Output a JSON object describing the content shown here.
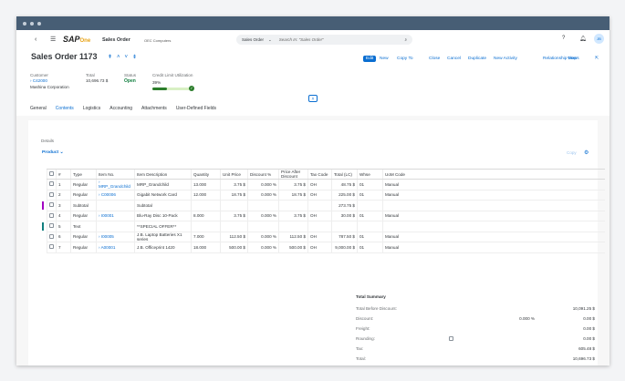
{
  "app": {
    "logo": "SAP Business One",
    "module": "Sales Order",
    "company": "OEC Computers",
    "search_scope": "Sales Order",
    "search_placeholder": "Search In: \"Sales Order\"",
    "avatar": "JB"
  },
  "header": {
    "title": "Sales Order 1173",
    "customer_label": "Customer",
    "customer_code": "C42000",
    "customer_name": "Mashina Corporation",
    "total_label": "Total",
    "total": "10,696.73 $",
    "status_label": "Status",
    "status": "Open",
    "credit_label": "Credit Limit Utilization",
    "credit_pct": "39%",
    "credit_value": 39
  },
  "toolbar": [
    "Edit",
    "New",
    "Copy To",
    "Close",
    "Cancel",
    "Duplicate",
    "New Activity",
    "Relationship Map",
    "Views"
  ],
  "tabs": [
    "General",
    "Contents",
    "Logistics",
    "Accounting",
    "Attachments",
    "User-Defined Fields"
  ],
  "details": {
    "label": "Details",
    "product": "Product",
    "copy": "Copy"
  },
  "columns": [
    "#",
    "Type",
    "Item No.",
    "Item Description",
    "Quantity",
    "Unit Price",
    "Discount %",
    "Price After Discount",
    "Tax Code",
    "Total (LC)",
    "Whse",
    "UoM Code"
  ],
  "rows": [
    [
      "1",
      "Regular",
      "MRP_Grandchild",
      "MRP_Grandchild",
      "13.000",
      "3.75 $",
      "0.000 %",
      "3.75 $",
      "OH",
      "48.75 $",
      "01",
      "Manual"
    ],
    [
      "2",
      "Regular",
      "C00006",
      "Gigabit Network Card",
      "12.000",
      "18.75 $",
      "0.000 %",
      "18.75 $",
      "OH",
      "225.00 $",
      "01",
      "Manual"
    ],
    [
      "3",
      "Subtotal",
      "",
      "Subtotal",
      "",
      "",
      "",
      "",
      "",
      "273.75 $",
      "",
      ""
    ],
    [
      "4",
      "Regular",
      "I00001",
      "Blu-Ray Disc 10-Pack",
      "8.000",
      "3.75 $",
      "0.000 %",
      "3.75 $",
      "OH",
      "30.00 $",
      "01",
      "Manual"
    ],
    [
      "5",
      "Text",
      "",
      "**SPECIAL OFFER**",
      "",
      "",
      "",
      "",
      "",
      "",
      "",
      ""
    ],
    [
      "6",
      "Regular",
      "I00005",
      "J.B. Laptop Batteries X1 series",
      "7.000",
      "112.50 $",
      "0.000 %",
      "112.50 $",
      "OH",
      "787.50 $",
      "01",
      "Manual"
    ],
    [
      "7",
      "Regular",
      "A00001",
      "J.B. Officeprint 1420",
      "18.000",
      "500.00 $",
      "0.000 %",
      "500.00 $",
      "OH",
      "9,000.00 $",
      "01",
      "Manual"
    ]
  ],
  "summary": {
    "title": "Total Summary",
    "lines": [
      {
        "label": "Total Before Discount:",
        "pct": "",
        "value": "10,091.25 $"
      },
      {
        "label": "Discount:",
        "pct": "0.000 %",
        "value": "0.00 $"
      },
      {
        "label": "Freight:",
        "pct": "",
        "value": "0.00 $"
      },
      {
        "label": "Rounding:",
        "pct": "",
        "value": "0.00 $"
      },
      {
        "label": "Tax:",
        "pct": "",
        "value": "605.48 $"
      },
      {
        "label": "Total:",
        "pct": "",
        "value": "10,696.73 $"
      }
    ]
  },
  "colors": {
    "accent": "#0a6ed1",
    "status_open": "#107e3e",
    "subtotal_marker": "#a100c2",
    "text_marker": "#107e7e"
  }
}
